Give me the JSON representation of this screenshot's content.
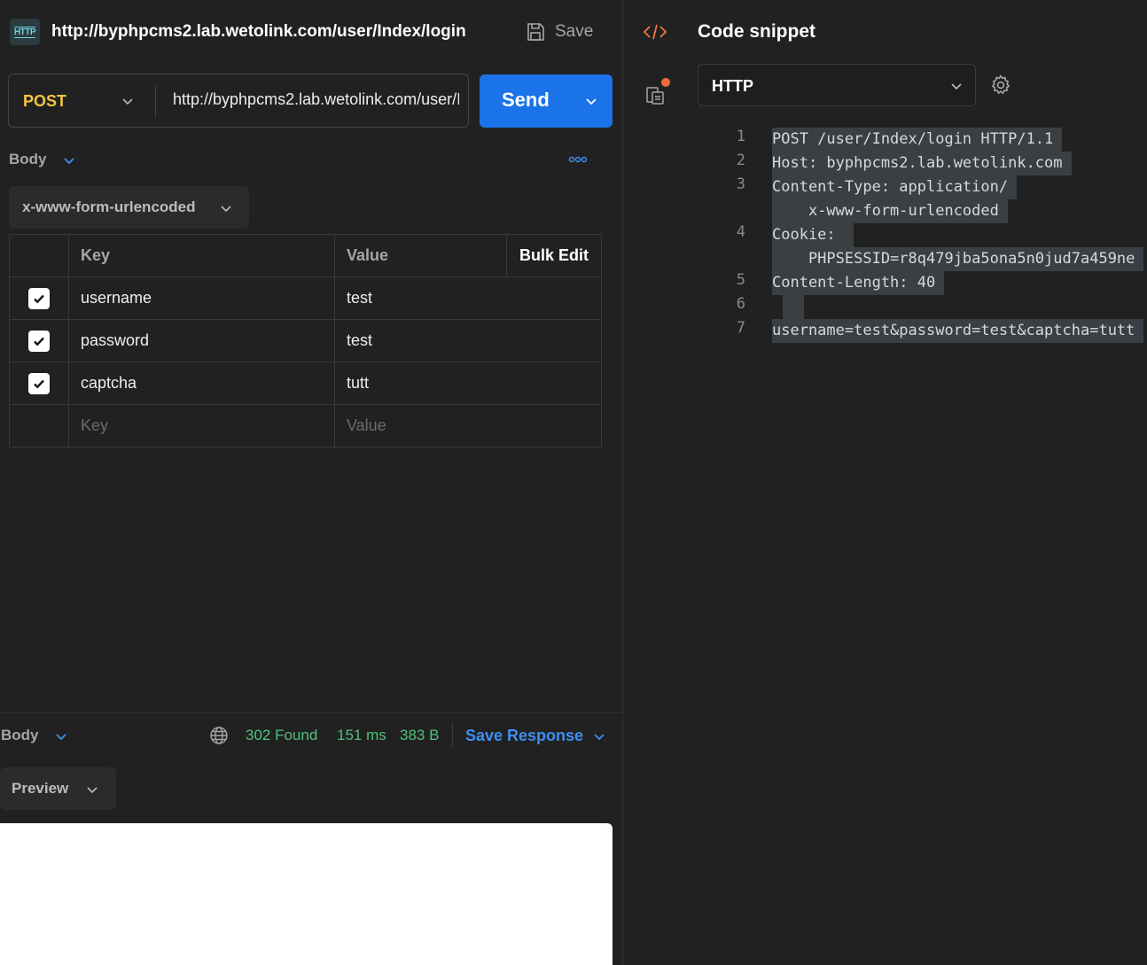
{
  "request": {
    "icon_label": "HTTP",
    "title": "http://byphpcms2.lab.wetolink.com/user/Index/login",
    "save_label": "Save",
    "method": "POST",
    "url": "http://byphpcms2.lab.wetolink.com/user/Index/login",
    "send_label": "Send"
  },
  "body": {
    "label": "Body",
    "encoding": "x-www-form-urlencoded",
    "columns": {
      "key": "Key",
      "value": "Value",
      "bulk": "Bulk Edit"
    },
    "rows": [
      {
        "key": "username",
        "value": "test",
        "checked": true
      },
      {
        "key": "password",
        "value": "test",
        "checked": true
      },
      {
        "key": "captcha",
        "value": "tutt",
        "checked": true
      }
    ],
    "placeholder_key": "Key",
    "placeholder_value": "Value"
  },
  "response": {
    "body_label": "Body",
    "status": "302 Found",
    "time": "151 ms",
    "size": "383 B",
    "save_response_label": "Save Response",
    "view_mode": "Preview"
  },
  "snippet": {
    "title": "Code snippet",
    "language": "HTTP",
    "lines": [
      {
        "n": "1",
        "text": "POST /user/Index/login HTTP/1.1"
      },
      {
        "n": "2",
        "text": "Host: byphpcms2.lab.wetolink.com"
      },
      {
        "n": "3",
        "text": "Content-Type: application/"
      },
      {
        "n": "",
        "text": "    x-www-form-urlencoded"
      },
      {
        "n": "4",
        "text": "Cookie: "
      },
      {
        "n": "",
        "text": "    PHPSESSID=r8q479jba5ona5n0jud7a459ne"
      },
      {
        "n": "5",
        "text": "Content-Length: 40"
      },
      {
        "n": "6",
        "text": ""
      },
      {
        "n": "7",
        "text": "username=test&password=test&captcha=tutt"
      }
    ]
  },
  "colors": {
    "accent": "#1a73e8",
    "method": "#f5c542",
    "success": "#4ec27a",
    "badge": "#f26b3a"
  }
}
